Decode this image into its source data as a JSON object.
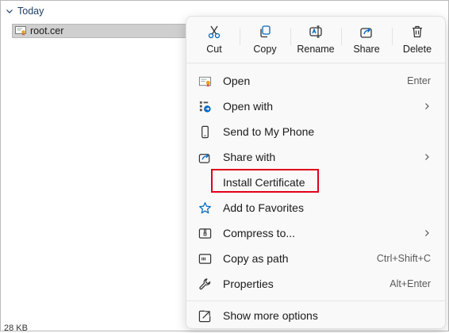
{
  "explorer": {
    "group_header": "Today",
    "file_name": "root.cer",
    "status_text": "28 KB"
  },
  "quick_actions": [
    {
      "label": "Cut",
      "icon": "cut-icon"
    },
    {
      "label": "Copy",
      "icon": "copy-icon"
    },
    {
      "label": "Rename",
      "icon": "rename-icon"
    },
    {
      "label": "Share",
      "icon": "share-icon"
    },
    {
      "label": "Delete",
      "icon": "delete-icon"
    }
  ],
  "menu": {
    "items": [
      {
        "label": "Open",
        "shortcut": "Enter",
        "icon": "certificate-icon"
      },
      {
        "label": "Open with",
        "submenu": true,
        "icon": "open-with-icon"
      },
      {
        "label": "Send to My Phone",
        "icon": "phone-icon"
      },
      {
        "label": "Share with",
        "submenu": true,
        "icon": "share-icon"
      },
      {
        "label": "Install Certificate",
        "icon": "none",
        "highlighted": true
      },
      {
        "label": "Add to Favorites",
        "icon": "star-icon"
      },
      {
        "label": "Compress to...",
        "submenu": true,
        "icon": "zip-icon"
      },
      {
        "label": "Copy as path",
        "shortcut": "Ctrl+Shift+C",
        "icon": "copy-path-icon"
      },
      {
        "label": "Properties",
        "shortcut": "Alt+Enter",
        "icon": "wrench-icon"
      }
    ],
    "more_options": {
      "label": "Show more options",
      "icon": "show-more-icon"
    }
  },
  "colors": {
    "accent": "#0067c0",
    "highlight_border": "#e2001a",
    "menu_background": "#f9f9f9",
    "selected_row": "#cfcfcf"
  }
}
